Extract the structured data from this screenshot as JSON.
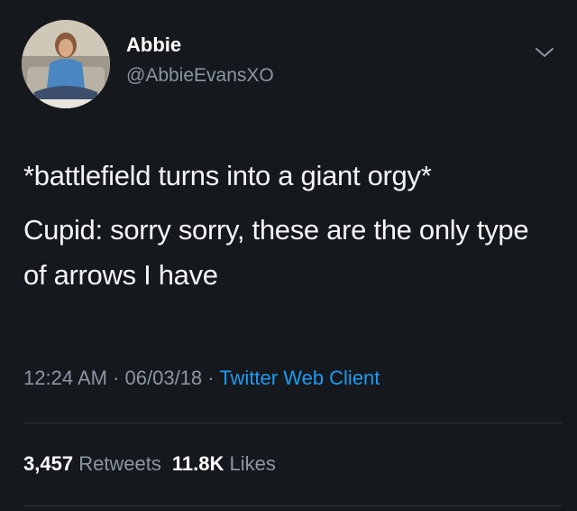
{
  "author": {
    "display_name": "Abbie",
    "handle": "@AbbieEvansXO"
  },
  "icons": {
    "more_menu": "chevron-down-icon",
    "avatar": "profile-photo"
  },
  "tweet": {
    "line1": "*battlefield turns into a giant orgy*",
    "line2": "Cupid: sorry sorry, these are the only type of arrows I have"
  },
  "meta": {
    "time": "12:24 AM",
    "sep1": " · ",
    "date": "06/03/18",
    "sep2": " · ",
    "client": "Twitter Web Client"
  },
  "stats": {
    "retweets_count": "3,457",
    "retweets_label": "Retweets",
    "likes_count": "11.8K",
    "likes_label": "Likes"
  },
  "colors": {
    "background": "#15181d",
    "secondary_text": "#8b96a3",
    "link": "#1d9bf0"
  }
}
